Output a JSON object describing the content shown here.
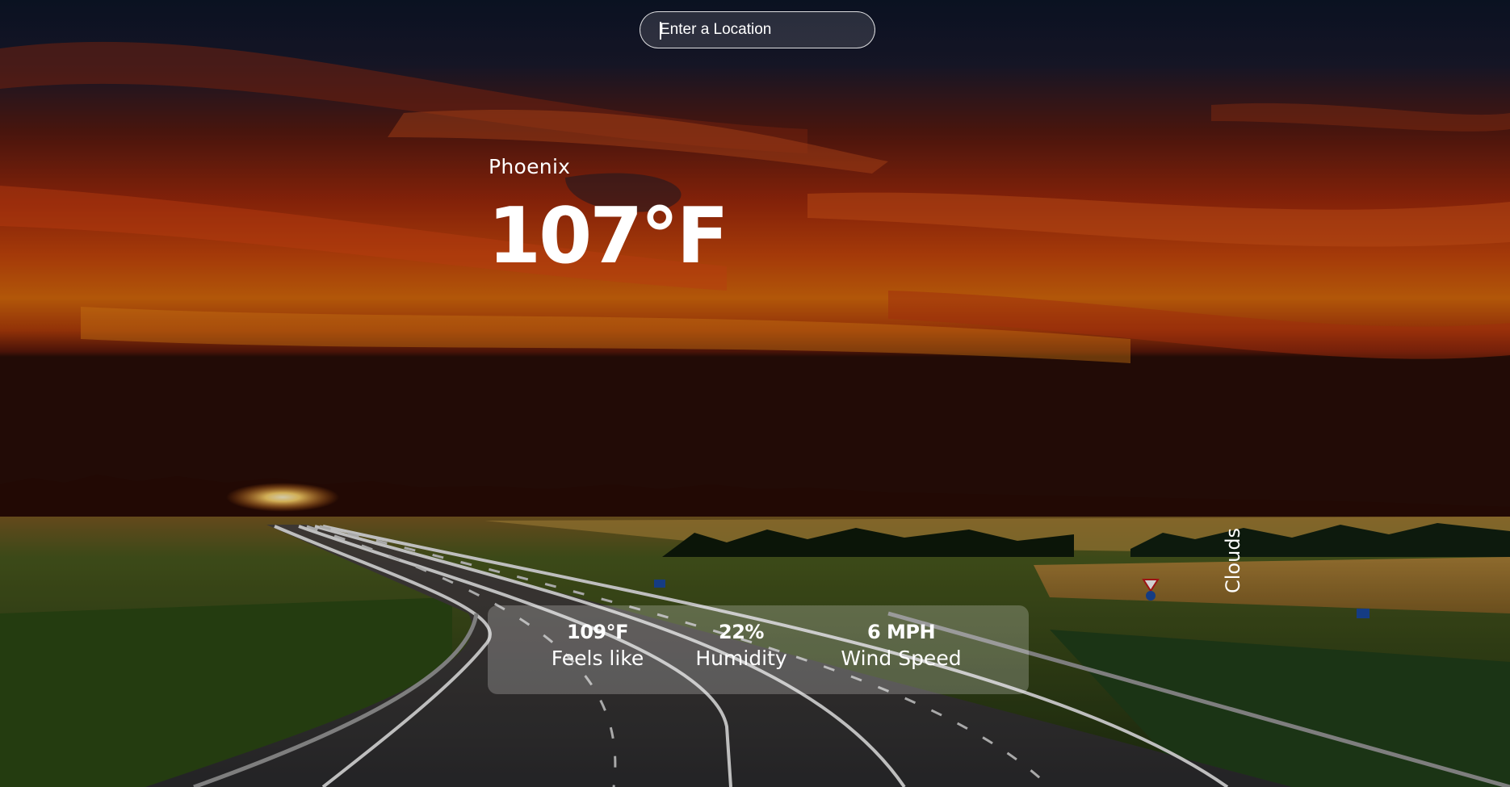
{
  "search": {
    "placeholder": "Enter a Location",
    "value": ""
  },
  "weather": {
    "city": "Phoenix",
    "temperature": "107°F",
    "description": "Clouds"
  },
  "stats": {
    "feels_like": {
      "value": "109°F",
      "label": "Feels like"
    },
    "humidity": {
      "value": "22%",
      "label": "Humidity"
    },
    "wind": {
      "value": "6 MPH",
      "label": "Wind Speed"
    }
  },
  "colors": {
    "text": "#ffffff",
    "sky_dark": "#0f1a30",
    "sunset_red": "#c8320e",
    "sunset_orange": "#e8780a",
    "field_green": "#3f5a1c",
    "road": "#3a3a3c"
  }
}
